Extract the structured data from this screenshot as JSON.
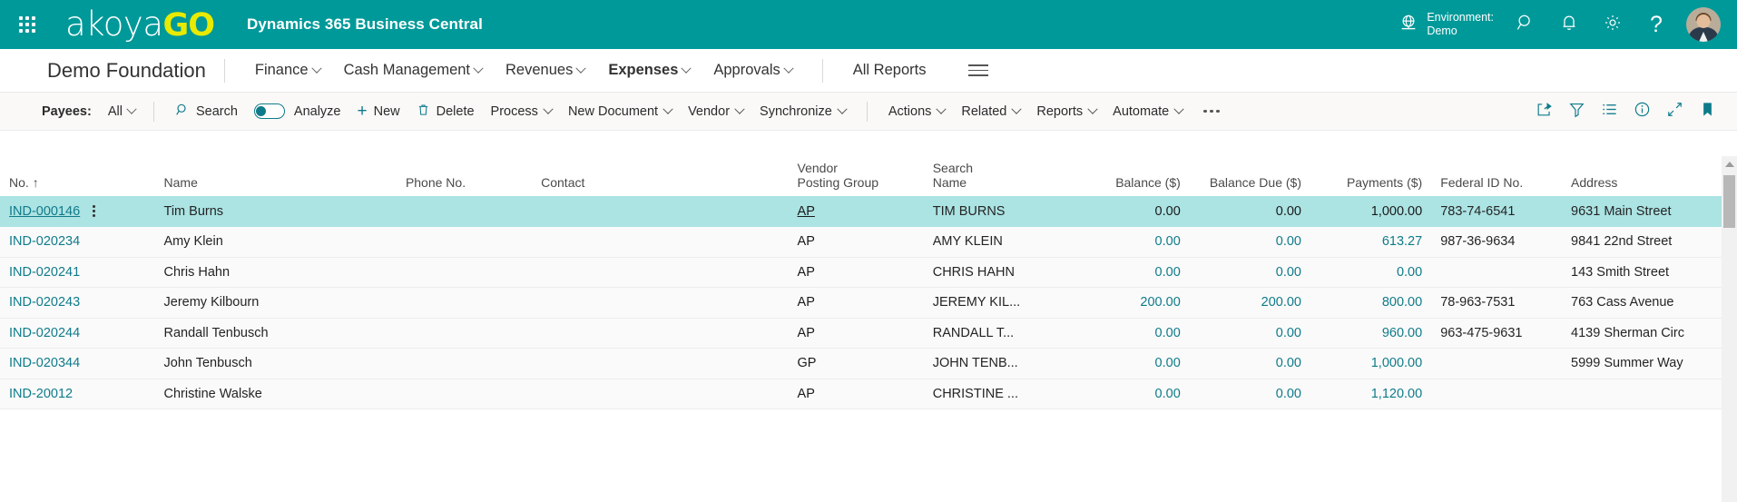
{
  "topbar": {
    "waffle_label": "App launcher",
    "brand_prefix": "akoya",
    "brand_suffix": "GO",
    "app_title": "Dynamics 365 Business Central",
    "environment_label": "Environment:",
    "environment_value": "Demo",
    "icons": {
      "globe": "globe-icon",
      "search": "search-icon",
      "notifications": "bell-icon",
      "settings": "gear-icon",
      "help": "question-mark-icon",
      "account": "user-avatar"
    },
    "accent_color": "#009999",
    "brand_accent_color": "#e8ea00"
  },
  "navbar": {
    "company": "Demo Foundation",
    "items": [
      {
        "label": "Finance",
        "has_menu": true,
        "active": false
      },
      {
        "label": "Cash Management",
        "has_menu": true,
        "active": false
      },
      {
        "label": "Revenues",
        "has_menu": true,
        "active": false
      },
      {
        "label": "Expenses",
        "has_menu": true,
        "active": true
      },
      {
        "label": "Approvals",
        "has_menu": true,
        "active": false
      }
    ],
    "all_reports": "All Reports",
    "more_menu": "hamburger-icon"
  },
  "toolbar": {
    "payees_label": "Payees:",
    "payees_value": "All",
    "search": "Search",
    "analyze": "Analyze",
    "analyze_on": true,
    "new": "New",
    "delete": "Delete",
    "process": "Process",
    "new_document": "New Document",
    "vendor": "Vendor",
    "synchronize": "Synchronize",
    "actions": "Actions",
    "related": "Related",
    "reports": "Reports",
    "automate": "Automate",
    "overflow": "...",
    "right_icons": [
      {
        "name": "share-icon"
      },
      {
        "name": "filter-icon"
      },
      {
        "name": "list-icon"
      },
      {
        "name": "info-icon"
      },
      {
        "name": "collapse-icon"
      },
      {
        "name": "bookmark-icon"
      }
    ]
  },
  "grid": {
    "columns": [
      {
        "key": "no",
        "label": "No.",
        "sorted": "ascending",
        "sort_glyph": "↑"
      },
      {
        "key": "name",
        "label": "Name"
      },
      {
        "key": "phone",
        "label": "Phone No."
      },
      {
        "key": "contact",
        "label": "Contact"
      },
      {
        "key": "vpg",
        "label_line1": "Vendor",
        "label_line2": "Posting Group"
      },
      {
        "key": "search_name",
        "label_line1": "Search",
        "label_line2": "Name"
      },
      {
        "key": "balance",
        "label": "Balance ($)",
        "align": "right"
      },
      {
        "key": "balance_due",
        "label": "Balance Due ($)",
        "align": "right"
      },
      {
        "key": "payments",
        "label": "Payments ($)",
        "align": "right"
      },
      {
        "key": "federal_id",
        "label": "Federal ID No."
      },
      {
        "key": "address",
        "label": "Address"
      }
    ],
    "rows": [
      {
        "no": "IND-000146",
        "name": "Tim Burns",
        "phone": "",
        "contact": "",
        "vpg": "AP",
        "search_name": "TIM BURNS",
        "balance": "0.00",
        "balance_due": "0.00",
        "payments": "1,000.00",
        "federal_id": "783-74-6541",
        "address": "9631 Main Street",
        "selected": true
      },
      {
        "no": "IND-020234",
        "name": "Amy Klein",
        "phone": "",
        "contact": "",
        "vpg": "AP",
        "search_name": "AMY KLEIN",
        "balance": "0.00",
        "balance_due": "0.00",
        "payments": "613.27",
        "federal_id": "987-36-9634",
        "address": "9841 22nd Street",
        "selected": false
      },
      {
        "no": "IND-020241",
        "name": "Chris Hahn",
        "phone": "",
        "contact": "",
        "vpg": "AP",
        "search_name": "CHRIS HAHN",
        "balance": "0.00",
        "balance_due": "0.00",
        "payments": "0.00",
        "federal_id": "",
        "address": "143 Smith Street",
        "selected": false
      },
      {
        "no": "IND-020243",
        "name": "Jeremy Kilbourn",
        "phone": "",
        "contact": "",
        "vpg": "AP",
        "search_name": "JEREMY KIL...",
        "balance": "200.00",
        "balance_due": "200.00",
        "payments": "800.00",
        "federal_id": "78-963-7531",
        "address": "763 Cass Avenue",
        "selected": false
      },
      {
        "no": "IND-020244",
        "name": "Randall Tenbusch",
        "phone": "",
        "contact": "",
        "vpg": "AP",
        "search_name": "RANDALL T...",
        "balance": "0.00",
        "balance_due": "0.00",
        "payments": "960.00",
        "federal_id": "963-475-9631",
        "address": "4139 Sherman Circ",
        "selected": false
      },
      {
        "no": "IND-020344",
        "name": "John Tenbusch",
        "phone": "",
        "contact": "",
        "vpg": "GP",
        "search_name": "JOHN TENB...",
        "balance": "0.00",
        "balance_due": "0.00",
        "payments": "1,000.00",
        "federal_id": "",
        "address": "5999 Summer Way",
        "selected": false
      },
      {
        "no": "IND-20012",
        "name": "Christine Walske",
        "phone": "",
        "contact": "",
        "vpg": "AP",
        "search_name": "CHRISTINE ...",
        "balance": "0.00",
        "balance_due": "0.00",
        "payments": "1,120.00",
        "federal_id": "",
        "address": "",
        "selected": false
      }
    ]
  }
}
